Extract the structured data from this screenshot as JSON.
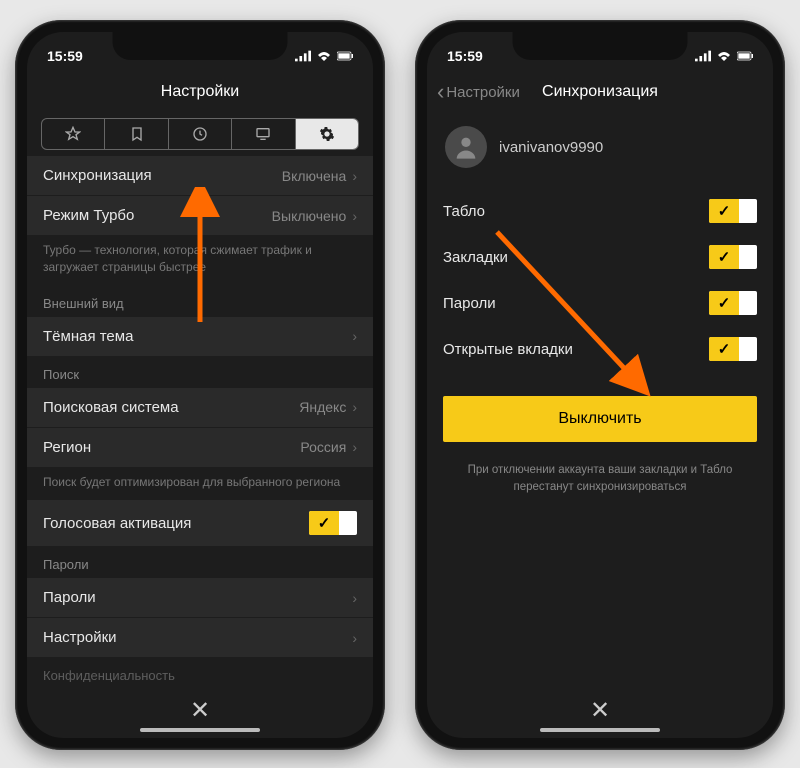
{
  "status": {
    "time": "15:59"
  },
  "left": {
    "title": "Настройки",
    "rows": {
      "sync": {
        "label": "Синхронизация",
        "value": "Включена"
      },
      "turbo": {
        "label": "Режим Турбо",
        "value": "Выключено"
      },
      "turbo_desc": "Турбо — технология, которая сжимает трафик и загружает страницы быстрее",
      "appearance_header": "Внешний вид",
      "dark": {
        "label": "Тёмная тема"
      },
      "search_header": "Поиск",
      "engine": {
        "label": "Поисковая система",
        "value": "Яндекс"
      },
      "region": {
        "label": "Регион",
        "value": "Россия"
      },
      "search_desc": "Поиск будет оптимизирован для выбранного региона",
      "voice": {
        "label": "Голосовая активация"
      },
      "passwords_header": "Пароли",
      "passwords": {
        "label": "Пароли"
      },
      "settings": {
        "label": "Настройки"
      },
      "privacy_header": "Конфиденциальность"
    }
  },
  "right": {
    "back": "Настройки",
    "title": "Синхронизация",
    "user": "ivanivanov9990",
    "items": {
      "tablo": "Табло",
      "bookmarks": "Закладки",
      "passwords": "Пароли",
      "tabs": "Открытые вкладки"
    },
    "disable_btn": "Выключить",
    "note": "При отключении аккаунта ваши закладки и Табло перестанут синхронизироваться"
  }
}
